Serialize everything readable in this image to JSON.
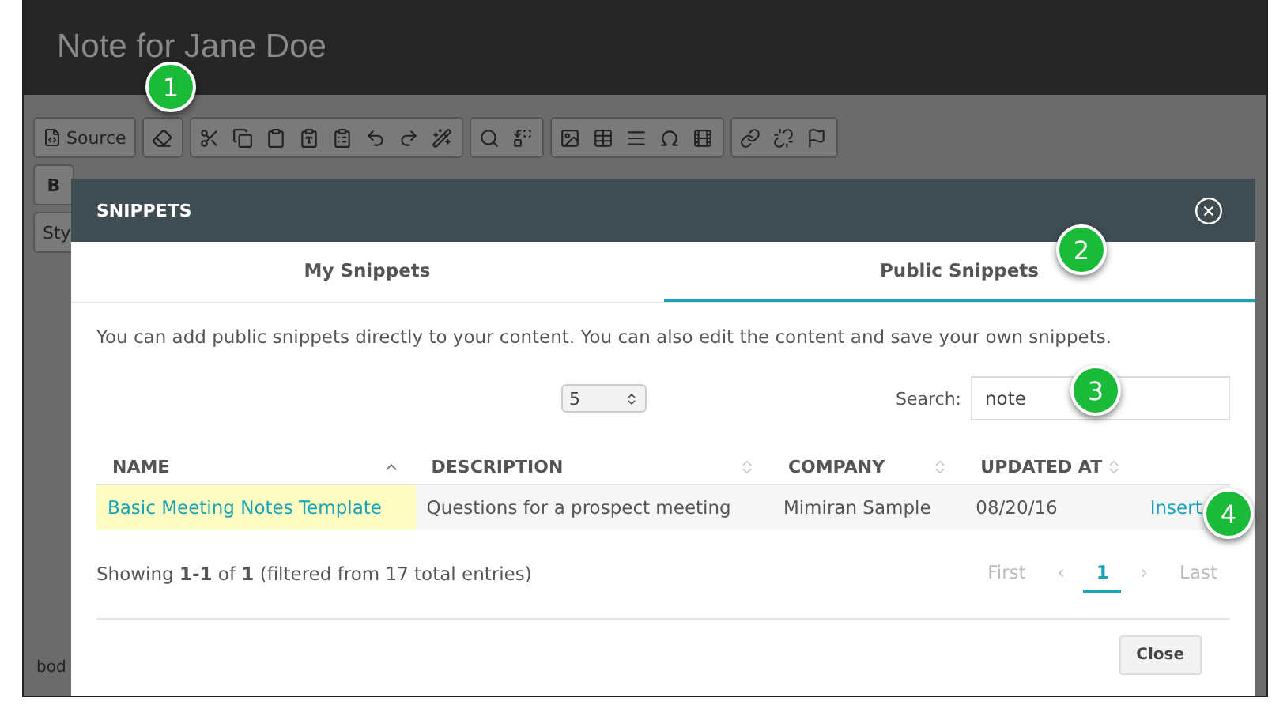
{
  "window": {
    "title": "Note for Jane Doe"
  },
  "toolbar": {
    "source_label": "Source",
    "bold_label": "B",
    "style_label": "Sty"
  },
  "status_path": "bod",
  "dialog": {
    "title": "SNIPPETS",
    "tabs": [
      {
        "label": "My Snippets",
        "selected": false
      },
      {
        "label": "Public Snippets",
        "selected": true
      }
    ],
    "intro": "You can add public snippets directly to your content. You can also edit the content and save your own snippets.",
    "page_size": "5",
    "search": {
      "label": "Search:",
      "value": "note"
    },
    "columns": [
      {
        "label": "NAME",
        "sorted": true
      },
      {
        "label": "DESCRIPTION",
        "sorted": false
      },
      {
        "label": "COMPANY",
        "sorted": false
      },
      {
        "label": "UPDATED AT",
        "sorted": false
      }
    ],
    "rows": [
      {
        "name": "Basic Meeting Notes Template",
        "description": "Questions for a prospect meeting",
        "company": "Mimiran Sample",
        "updated": "08/20/16",
        "action": "Insert"
      }
    ],
    "info": "Showing **1-1** of **1** (filtered from 17 total entries)",
    "pagination": [
      {
        "label": "First",
        "selected": false,
        "disabled": true
      },
      {
        "label": "‹",
        "selected": false,
        "disabled": true
      },
      {
        "label": "1",
        "selected": true,
        "disabled": false
      },
      {
        "label": "›",
        "selected": false,
        "disabled": true
      },
      {
        "label": "Last",
        "selected": false,
        "disabled": true
      }
    ],
    "close": "Close"
  },
  "callouts": [
    {
      "label": "1"
    },
    {
      "label": "2"
    },
    {
      "label": "3"
    },
    {
      "label": "4"
    }
  ]
}
